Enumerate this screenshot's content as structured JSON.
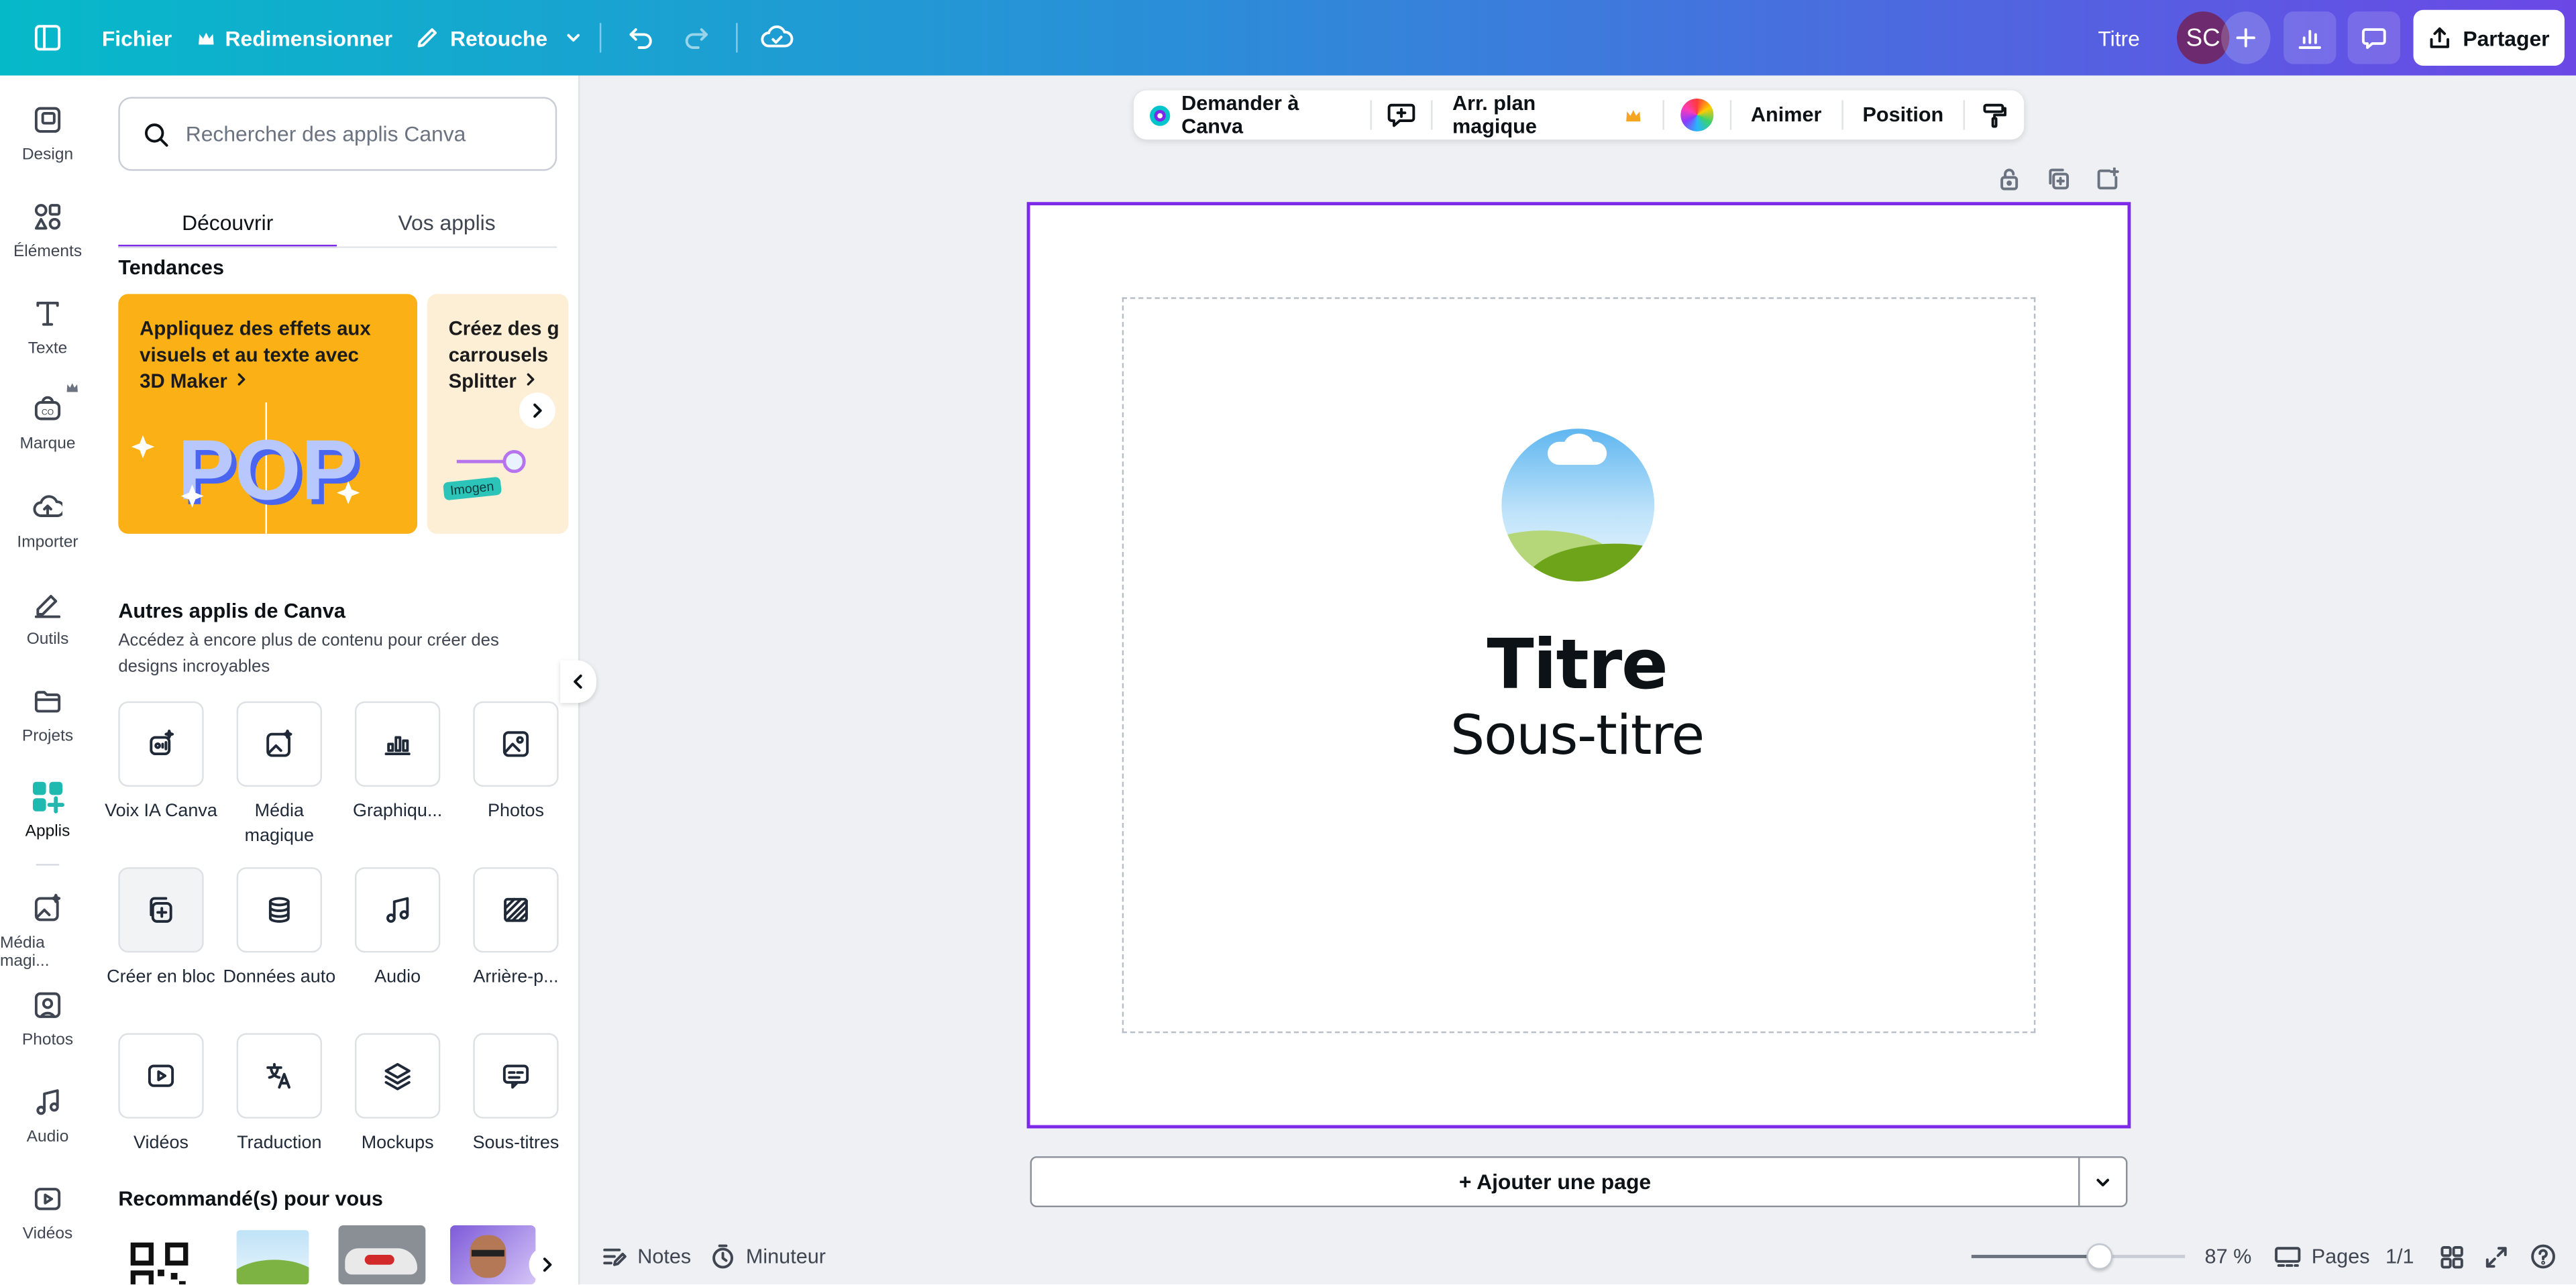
{
  "topbar": {
    "file": "Fichier",
    "resize": "Redimensionner",
    "edit_mode": "Retouche",
    "doc_title": "Titre",
    "avatar_initials": "SC",
    "share": "Partager"
  },
  "rail": {
    "items": [
      {
        "label": "Design",
        "icon": "design-icon"
      },
      {
        "label": "Éléments",
        "icon": "elements-icon"
      },
      {
        "label": "Texte",
        "icon": "text-icon"
      },
      {
        "label": "Marque",
        "icon": "brand-icon"
      },
      {
        "label": "Importer",
        "icon": "upload-icon"
      },
      {
        "label": "Outils",
        "icon": "tools-icon"
      },
      {
        "label": "Projets",
        "icon": "folder-icon"
      },
      {
        "label": "Applis",
        "icon": "apps-icon"
      },
      {
        "label": "Média magi...",
        "icon": "magic-media-icon"
      },
      {
        "label": "Photos",
        "icon": "photo-icon"
      },
      {
        "label": "Audio",
        "icon": "music-icon"
      },
      {
        "label": "Vidéos",
        "icon": "video-icon"
      }
    ]
  },
  "panel": {
    "search_placeholder": "Rechercher des applis Canva",
    "tabs": [
      "Découvrir",
      "Vos applis"
    ],
    "trending_title": "Tendances",
    "trend_cards": [
      {
        "text": "Appliquez des effets aux visuels et au texte avec",
        "link": "3D Maker",
        "art": "POP"
      },
      {
        "text": "Créez des g carrousels",
        "link": "Splitter",
        "tag": "Imogen"
      }
    ],
    "other_apps_title": "Autres applis de Canva",
    "other_apps_desc": "Accédez à encore plus de contenu pour créer des designs incroyables",
    "apps": [
      {
        "label": "Voix IA Canva",
        "icon": "ai-voice-icon"
      },
      {
        "label": "Média magique",
        "icon": "magic-media-icon"
      },
      {
        "label": "Graphiqu...",
        "icon": "chart-icon"
      },
      {
        "label": "Photos",
        "icon": "photo-icon"
      },
      {
        "label": "Créer en bloc",
        "icon": "bulk-create-icon"
      },
      {
        "label": "Données auto",
        "icon": "database-icon"
      },
      {
        "label": "Audio",
        "icon": "music-icon"
      },
      {
        "label": "Arrière-p...",
        "icon": "background-icon"
      },
      {
        "label": "Vidéos",
        "icon": "video-icon"
      },
      {
        "label": "Traduction",
        "icon": "translate-icon"
      },
      {
        "label": "Mockups",
        "icon": "layers-icon"
      },
      {
        "label": "Sous-titres",
        "icon": "subtitles-icon"
      }
    ],
    "recommended_title": "Recommandé(s) pour vous"
  },
  "context_toolbar": {
    "ask_canva": "Demander à Canva",
    "magic_bg": "Arr. plan magique",
    "animate": "Animer",
    "position": "Position"
  },
  "canvas": {
    "title": "Titre",
    "subtitle": "Sous-titre",
    "accent": "#7d2ae8"
  },
  "footer": {
    "add_page": "+ Ajouter une page",
    "notes": "Notes",
    "timer": "Minuteur",
    "zoom": "87 %",
    "zoom_level": 0.6,
    "pages": "Pages",
    "page_count": "1/1"
  }
}
